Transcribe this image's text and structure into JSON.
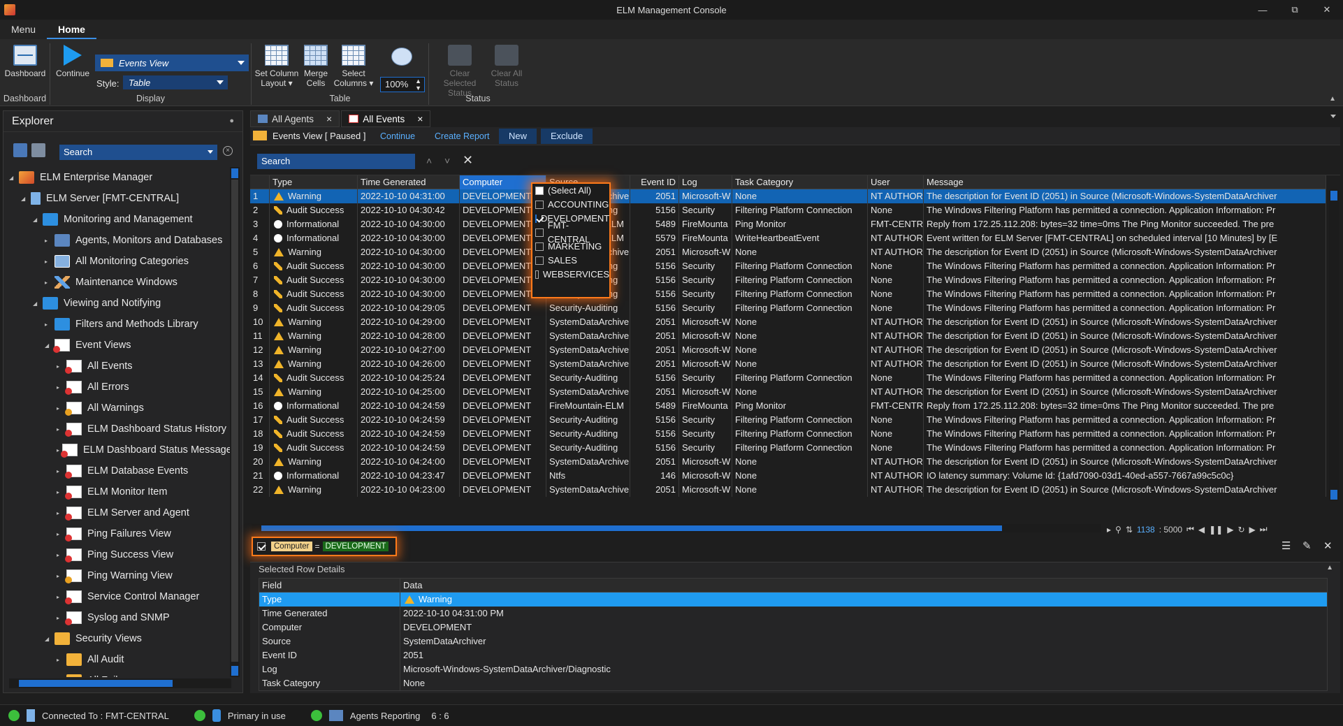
{
  "window": {
    "title": "ELM Management Console"
  },
  "ribbon": {
    "tabs": [
      "Menu",
      "Home"
    ],
    "groups": {
      "dashboard": {
        "label": "Dashboard",
        "button": "Dashboard"
      },
      "display": {
        "label": "Display",
        "continue": "Continue",
        "view_combo": "Events View",
        "style_label": "Style:",
        "style_combo": "Table"
      },
      "table": {
        "label": "Table",
        "set_column_layout_1": "Set Column",
        "set_column_layout_2": "Layout",
        "merge_1": "Merge",
        "merge_2": "Cells",
        "select_columns_1": "Select",
        "select_columns_2": "Columns",
        "zoom": "100%"
      },
      "status": {
        "label": "Status",
        "clear_selected_1": "Clear Selected",
        "clear_selected_2": "Status",
        "clear_all_1": "Clear All",
        "clear_all_2": "Status"
      }
    }
  },
  "explorer": {
    "title": "Explorer",
    "search_placeholder": "Search",
    "tree": [
      {
        "label": "ELM Enterprise Manager",
        "icon": "em-icon",
        "level": 0
      },
      {
        "label": "ELM Server [FMT-CENTRAL]",
        "icon": "server-icon",
        "level": 1
      },
      {
        "label": "Monitoring and Management",
        "icon": "folder-icon",
        "level": 2
      },
      {
        "label": "Agents, Monitors and Databases",
        "icon": "agents-icon",
        "level": 3
      },
      {
        "label": "All Monitoring Categories",
        "icon": "category-icon",
        "level": 3
      },
      {
        "label": "Maintenance Windows",
        "icon": "tools-icon",
        "level": 3
      },
      {
        "label": "Viewing and Notifying",
        "icon": "folder-icon",
        "level": 2
      },
      {
        "label": "Filters and Methods Library",
        "icon": "folder-icon",
        "level": 3
      },
      {
        "label": "Event Views",
        "icon": "view-icon",
        "level": 3
      },
      {
        "label": "All  Events",
        "icon": "view-icon",
        "level": 4
      },
      {
        "label": "All Errors",
        "icon": "view-icon",
        "level": 4
      },
      {
        "label": "All Warnings",
        "icon": "view-warn-icon",
        "level": 4
      },
      {
        "label": "ELM Dashboard Status History",
        "icon": "view-icon",
        "level": 4
      },
      {
        "label": "ELM Dashboard Status Messages",
        "icon": "view-icon",
        "level": 4
      },
      {
        "label": "ELM Database Events",
        "icon": "view-icon",
        "level": 4
      },
      {
        "label": "ELM Monitor Item",
        "icon": "view-icon",
        "level": 4
      },
      {
        "label": "ELM Server and Agent",
        "icon": "view-icon",
        "level": 4
      },
      {
        "label": "Ping Failures View",
        "icon": "view-icon",
        "level": 4
      },
      {
        "label": "Ping Success View",
        "icon": "view-icon",
        "level": 4
      },
      {
        "label": "Ping Warning View",
        "icon": "view-warn-icon",
        "level": 4
      },
      {
        "label": "Service Control Manager",
        "icon": "view-icon",
        "level": 4
      },
      {
        "label": "Syslog and SNMP",
        "icon": "view-icon",
        "level": 4
      },
      {
        "label": "Security Views",
        "icon": "security-icon",
        "level": 3
      },
      {
        "label": "All Audit",
        "icon": "security-icon",
        "level": 4
      },
      {
        "label": "All Failures",
        "icon": "security-icon",
        "level": 4
      }
    ]
  },
  "doc_tabs": [
    {
      "label": "All Agents",
      "active": false
    },
    {
      "label": "All  Events",
      "active": true
    }
  ],
  "view_bar": {
    "title": "Events View [ Paused ]",
    "continue": "Continue",
    "create_report": "Create Report",
    "new": "New",
    "exclude": "Exclude"
  },
  "grid": {
    "search_placeholder": "Search",
    "columns": [
      "",
      "Type",
      "Time Generated",
      "Computer",
      "Source",
      "Event ID",
      "Log",
      "Task Category",
      "User",
      "Message"
    ],
    "rows": [
      [
        "1",
        "Warning",
        "2022-10-10 04:31:00",
        "DEVELOPMENT",
        "SystemDataArchiver",
        "2051",
        "Microsoft-W",
        "None",
        "NT AUTHOR",
        "The description for Event ID (2051) in Source (Microsoft-Windows-SystemDataArchiver"
      ],
      [
        "2",
        "Audit Success",
        "2022-10-10 04:30:42",
        "DEVELOPMENT",
        "Security-Auditing",
        "5156",
        "Security",
        "Filtering Platform Connection",
        "None",
        "The Windows Filtering Platform has permitted a connection. Application Information: Pr"
      ],
      [
        "3",
        "Informational",
        "2022-10-10 04:30:00",
        "DEVELOPMENT",
        "FireMountain-ELM",
        "5489",
        "FireMounta",
        "Ping Monitor",
        "FMT-CENTR.",
        "Reply from 172.25.112.208: bytes=32 time=0ms The Ping Monitor succeeded. The pre"
      ],
      [
        "4",
        "Informational",
        "2022-10-10 04:30:00",
        "DEVELOPMENT",
        "FireMountain-ELM",
        "5579",
        "FireMounta",
        "WriteHeartbeatEvent",
        "NT AUTHOR",
        "Event written for ELM Server [FMT-CENTRAL] on scheduled interval [10 Minutes] by [E"
      ],
      [
        "5",
        "Warning",
        "2022-10-10 04:30:00",
        "DEVELOPMENT",
        "SystemDataArchiver",
        "2051",
        "Microsoft-W",
        "None",
        "NT AUTHOR",
        "The description for Event ID (2051) in Source (Microsoft-Windows-SystemDataArchiver"
      ],
      [
        "6",
        "Audit Success",
        "2022-10-10 04:30:00",
        "DEVELOPMENT",
        "Security-Auditing",
        "5156",
        "Security",
        "Filtering Platform Connection",
        "None",
        "The Windows Filtering Platform has permitted a connection. Application Information: Pr"
      ],
      [
        "7",
        "Audit Success",
        "2022-10-10 04:30:00",
        "DEVELOPMENT",
        "Security-Auditing",
        "5156",
        "Security",
        "Filtering Platform Connection",
        "None",
        "The Windows Filtering Platform has permitted a connection. Application Information: Pr"
      ],
      [
        "8",
        "Audit Success",
        "2022-10-10 04:30:00",
        "DEVELOPMENT",
        "Security-Auditing",
        "5156",
        "Security",
        "Filtering Platform Connection",
        "None",
        "The Windows Filtering Platform has permitted a connection. Application Information: Pr"
      ],
      [
        "9",
        "Audit Success",
        "2022-10-10 04:29:05",
        "DEVELOPMENT",
        "Security-Auditing",
        "5156",
        "Security",
        "Filtering Platform Connection",
        "None",
        "The Windows Filtering Platform has permitted a connection. Application Information: Pr"
      ],
      [
        "10",
        "Warning",
        "2022-10-10 04:29:00",
        "DEVELOPMENT",
        "SystemDataArchiver",
        "2051",
        "Microsoft-W",
        "None",
        "NT AUTHOR",
        "The description for Event ID (2051) in Source (Microsoft-Windows-SystemDataArchiver"
      ],
      [
        "11",
        "Warning",
        "2022-10-10 04:28:00",
        "DEVELOPMENT",
        "SystemDataArchiver",
        "2051",
        "Microsoft-W",
        "None",
        "NT AUTHOR",
        "The description for Event ID (2051) in Source (Microsoft-Windows-SystemDataArchiver"
      ],
      [
        "12",
        "Warning",
        "2022-10-10 04:27:00",
        "DEVELOPMENT",
        "SystemDataArchiver",
        "2051",
        "Microsoft-W",
        "None",
        "NT AUTHOR",
        "The description for Event ID (2051) in Source (Microsoft-Windows-SystemDataArchiver"
      ],
      [
        "13",
        "Warning",
        "2022-10-10 04:26:00",
        "DEVELOPMENT",
        "SystemDataArchiver",
        "2051",
        "Microsoft-W",
        "None",
        "NT AUTHOR",
        "The description for Event ID (2051) in Source (Microsoft-Windows-SystemDataArchiver"
      ],
      [
        "14",
        "Audit Success",
        "2022-10-10 04:25:24",
        "DEVELOPMENT",
        "Security-Auditing",
        "5156",
        "Security",
        "Filtering Platform Connection",
        "None",
        "The Windows Filtering Platform has permitted a connection. Application Information: Pr"
      ],
      [
        "15",
        "Warning",
        "2022-10-10 04:25:00",
        "DEVELOPMENT",
        "SystemDataArchiver",
        "2051",
        "Microsoft-W",
        "None",
        "NT AUTHOR",
        "The description for Event ID (2051) in Source (Microsoft-Windows-SystemDataArchiver"
      ],
      [
        "16",
        "Informational",
        "2022-10-10 04:24:59",
        "DEVELOPMENT",
        "FireMountain-ELM",
        "5489",
        "FireMounta",
        "Ping Monitor",
        "FMT-CENTR.",
        "Reply from 172.25.112.208: bytes=32 time=0ms The Ping Monitor succeeded. The pre"
      ],
      [
        "17",
        "Audit Success",
        "2022-10-10 04:24:59",
        "DEVELOPMENT",
        "Security-Auditing",
        "5156",
        "Security",
        "Filtering Platform Connection",
        "None",
        "The Windows Filtering Platform has permitted a connection. Application Information: Pr"
      ],
      [
        "18",
        "Audit Success",
        "2022-10-10 04:24:59",
        "DEVELOPMENT",
        "Security-Auditing",
        "5156",
        "Security",
        "Filtering Platform Connection",
        "None",
        "The Windows Filtering Platform has permitted a connection. Application Information: Pr"
      ],
      [
        "19",
        "Audit Success",
        "2022-10-10 04:24:59",
        "DEVELOPMENT",
        "Security-Auditing",
        "5156",
        "Security",
        "Filtering Platform Connection",
        "None",
        "The Windows Filtering Platform has permitted a connection. Application Information: Pr"
      ],
      [
        "20",
        "Warning",
        "2022-10-10 04:24:00",
        "DEVELOPMENT",
        "SystemDataArchiver",
        "2051",
        "Microsoft-W",
        "None",
        "NT AUTHOR",
        "The description for Event ID (2051) in Source (Microsoft-Windows-SystemDataArchiver"
      ],
      [
        "21",
        "Informational",
        "2022-10-10 04:23:47",
        "DEVELOPMENT",
        "Ntfs",
        "146",
        "Microsoft-W",
        "None",
        "NT AUTHOR",
        "IO latency summary:           Volume Id: {1afd7090-03d1-40ed-a557-7667a99c5c0c}"
      ],
      [
        "22",
        "Warning",
        "2022-10-10 04:23:00",
        "DEVELOPMENT",
        "SystemDataArchiver",
        "2051",
        "Microsoft-W",
        "None",
        "NT AUTHOR",
        "The description for Event ID (2051) in Source (Microsoft-Windows-SystemDataArchiver"
      ]
    ],
    "computer_filter_options": [
      {
        "label": "(Select All)",
        "state": "partial"
      },
      {
        "label": "ACCOUNTING",
        "state": "off"
      },
      {
        "label": "DEVELOPMENT",
        "state": "on"
      },
      {
        "label": "FMT-CENTRAL",
        "state": "off"
      },
      {
        "label": "MARKETING",
        "state": "off"
      },
      {
        "label": "SALES",
        "state": "off"
      },
      {
        "label": "WEBSERVICES",
        "state": "off"
      }
    ],
    "pager": {
      "current": "1138",
      "total": ": 5000"
    }
  },
  "filter_bar": {
    "field": "Computer",
    "operator": "=",
    "value": "DEVELOPMENT"
  },
  "details": {
    "title": "Selected Row Details",
    "header": [
      "Field",
      "Data"
    ],
    "rows": [
      [
        "Type",
        "Warning"
      ],
      [
        "Time Generated",
        "2022-10-10 04:31:00 PM"
      ],
      [
        "Computer",
        "DEVELOPMENT"
      ],
      [
        "Source",
        "SystemDataArchiver"
      ],
      [
        "Event ID",
        "2051"
      ],
      [
        "Log",
        "Microsoft-Windows-SystemDataArchiver/Diagnostic"
      ],
      [
        "Task Category",
        "None"
      ]
    ]
  },
  "status_bar": {
    "connected": "Connected To : FMT-CENTRAL",
    "primary": "Primary in use",
    "agents": "Agents Reporting",
    "agents_count": "6 : 6"
  },
  "colors": {
    "accent": "#1f6fd0",
    "selection": "#1264b4",
    "highlight": "#ff7a1a",
    "ok": "#3cbf3c"
  }
}
